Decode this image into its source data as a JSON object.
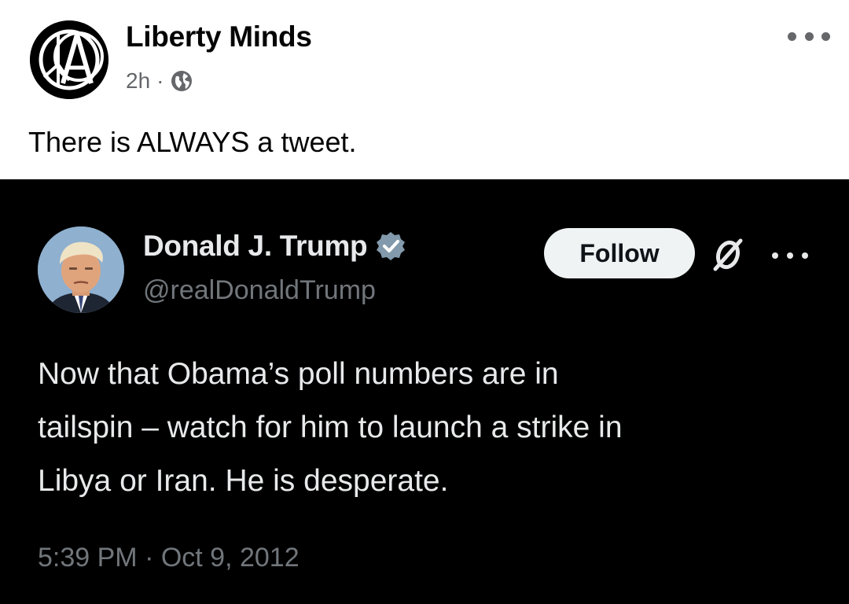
{
  "post": {
    "page_name": "Liberty Minds",
    "time_ago": "2h",
    "separator": "·",
    "audience_icon": "globe-icon",
    "text": "There is ALWAYS a tweet."
  },
  "tweet": {
    "author_name": "Donald J. Trump",
    "verified_icon": "verified-badge-icon",
    "handle": "@realDonaldTrump",
    "follow_label": "Follow",
    "platform_icon": "x-logo-icon",
    "body": "Now that Obama’s poll numbers are in\ntailspin – watch for him to launch a strike in\nLibya or Iran.  He is desperate.",
    "timestamp": "5:39 PM · Oct 9, 2012"
  },
  "colors": {
    "fb_background": "#ffffff",
    "fb_text": "#050505",
    "fb_secondary": "#65676b",
    "tweet_background": "#000000",
    "tweet_text": "#e7e9ea",
    "tweet_secondary": "#71767b",
    "verified_badge": "#829aab",
    "follow_button_bg": "#eff3f4"
  }
}
